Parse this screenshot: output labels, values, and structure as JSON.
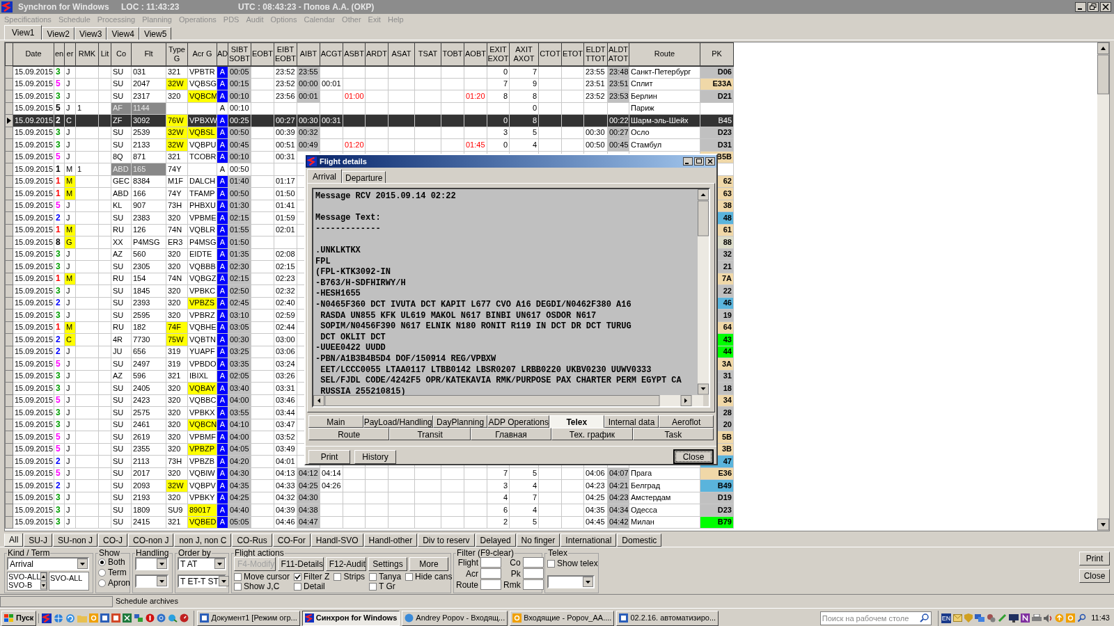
{
  "window": {
    "title": "Synchron for Windows",
    "loc": "LOC : 11:43:23",
    "utc": "UTC : 08:43:23 - Попов А.А. (ОКР)"
  },
  "menu": [
    "Specifications",
    "Schedule",
    "Processing",
    "Planning",
    "Operations",
    "PDS",
    "Audit",
    "Options",
    "Calendar",
    "Other",
    "Exit",
    "Help"
  ],
  "view_tabs": [
    {
      "label": "View1",
      "selected": true
    },
    {
      "label": "View2",
      "selected": false
    },
    {
      "label": "View3",
      "selected": false
    },
    {
      "label": "View4",
      "selected": false
    },
    {
      "label": "View5",
      "selected": false
    }
  ],
  "table": {
    "columns": [
      "Date",
      "en",
      "er",
      "RMK",
      "Lit",
      "Co",
      "Flt",
      "Type G",
      "Acr G",
      "AD",
      "SIBT SOBT",
      "EOBT",
      "EIBT EOBT",
      "AIBT",
      "ACGT",
      "ASBT",
      "ARDT",
      "ASAT",
      "TSAT",
      "TOBT",
      "AOBT",
      "EXIT EXOT",
      "AXIT AXOT",
      "CTOT",
      "ETOT",
      "ELDT TTOT",
      "ALDT ATOT",
      "Route",
      "PK"
    ],
    "rows": [
      {
        "date": "15.09.2015",
        "ter": {
          "text": "3",
          "color": "#00a000"
        },
        "cls": "J",
        "cls_marked": false,
        "co": "SU",
        "flt": "031",
        "type": "321",
        "type_marked": false,
        "acr": "VPBTR",
        "acr_marked": false,
        "ad": "A",
        "confirmed": true,
        "sibt": "00:05",
        "eibt": "23:52",
        "aibt": "23:55",
        "exit": "0",
        "axit": "7",
        "eldt": "23:55",
        "aldt": "23:48",
        "route": "Санкт-Петербург",
        "pk": {
          "text": "D06",
          "color": "#c0c0c0"
        },
        "selected": false
      },
      {
        "date": "15.09.2015",
        "ter": {
          "text": "5",
          "color": "#ff00ff"
        },
        "cls": "J",
        "cls_marked": false,
        "co": "SU",
        "flt": "2047",
        "type": "32W",
        "type_marked": true,
        "acr": "VQBSG",
        "acr_marked": false,
        "ad": "A",
        "confirmed": true,
        "sibt": "00:15",
        "eibt": "23:52",
        "aibt": "00:00",
        "acgt": "00:01",
        "exit": "7",
        "axit": "9",
        "eldt": "23:51",
        "aldt": "23:51",
        "route": "Сплит",
        "pk": {
          "text": "E33A",
          "color": "#f0d8a8"
        },
        "selected": false
      },
      {
        "date": "15.09.2015",
        "ter": {
          "text": "3",
          "color": "#00a000"
        },
        "cls": "J",
        "cls_marked": false,
        "co": "SU",
        "flt": "2317",
        "type": "320",
        "type_marked": false,
        "acr": "VQBCM",
        "acr_marked": true,
        "ad": "A",
        "confirmed": true,
        "sibt": "00:10",
        "eibt": "23:56",
        "aibt": "00:01",
        "asbt": "01:00",
        "aobt": "01:20",
        "exit": "8",
        "axit": "8",
        "eldt": "23:52",
        "aldt": "23:53",
        "route": "Берлин",
        "pk": {
          "text": "D21",
          "color": "#c0c0c0"
        },
        "selected": false
      },
      {
        "date": "15.09.2015",
        "ter": {
          "text": "5",
          "color": "#000000"
        },
        "cls": "J",
        "cls_marked": false,
        "rmk": "1",
        "co": "AF",
        "flt": "1144",
        "type_marked": false,
        "acr_marked": false,
        "ad": "A",
        "confirmed": false,
        "sibt": "00:10",
        "axit": "0",
        "route": "Париж",
        "selected": false
      },
      {
        "date": "15.09.2015",
        "ter": {
          "text": "2",
          "color": "#ffffff"
        },
        "cls": "C",
        "cls_marked": false,
        "co": "ZF",
        "flt": "3092",
        "type": "76W",
        "type_marked": true,
        "acr": "VPBXW",
        "acr_marked": false,
        "ad": "A",
        "confirmed": true,
        "sibt": "00:25",
        "eibt": "00:27",
        "aibt": "00:30",
        "acgt": "00:31",
        "exit": "0",
        "axit": "8",
        "aldt": "00:22",
        "route": "Шарм-эль-Шейх",
        "pk": {
          "text": "B45"
        },
        "selected": true
      },
      {
        "date": "15.09.2015",
        "ter": {
          "text": "3",
          "color": "#00a000"
        },
        "cls": "J",
        "cls_marked": false,
        "co": "SU",
        "flt": "2539",
        "type": "32W",
        "type_marked": true,
        "acr": "VQBSL",
        "acr_marked": true,
        "ad": "A",
        "confirmed": true,
        "sibt": "00:50",
        "eibt": "00:39",
        "aibt": "00:32",
        "exit": "3",
        "axit": "5",
        "eldt": "00:30",
        "aldt": "00:27",
        "route": "Осло",
        "pk": {
          "text": "D23",
          "color": "#c0c0c0"
        },
        "selected": false
      },
      {
        "date": "15.09.2015",
        "ter": {
          "text": "3",
          "color": "#00a000"
        },
        "cls": "J",
        "cls_marked": false,
        "co": "SU",
        "flt": "2133",
        "type": "32W",
        "type_marked": true,
        "acr": "VQBPU",
        "acr_marked": false,
        "ad": "A",
        "confirmed": true,
        "sibt": "00:45",
        "eibt": "00:51",
        "aibt": "00:49",
        "asbt": "01:20",
        "aobt": "01:45",
        "exit": "0",
        "axit": "4",
        "eldt": "00:50",
        "aldt": "00:45",
        "route": "Стамбул",
        "pk": {
          "text": "D31",
          "color": "#c0c0c0"
        },
        "selected": false
      },
      {
        "date": "15.09.2015",
        "ter": {
          "text": "5",
          "color": "#ff00ff"
        },
        "cls": "J",
        "cls_marked": false,
        "co": "8Q",
        "flt": "871",
        "type": "321",
        "type_marked": false,
        "acr": "TCOBR",
        "acr_marked": false,
        "ad": "A",
        "confirmed": true,
        "sibt": "00:10",
        "eibt": "00:31",
        "pk": {
          "text": "B5B",
          "color": "#f0d8a8"
        },
        "selected": false
      },
      {
        "date": "15.09.2015",
        "ter": {
          "text": "1",
          "color": "#000000"
        },
        "cls": "M",
        "cls_marked": false,
        "rmk": "1",
        "co": "ABD",
        "flt": "165",
        "type": "74Y",
        "type_marked": false,
        "acr_marked": false,
        "ad": "A",
        "confirmed": false,
        "sibt": "00:50",
        "selected": false
      },
      {
        "date": "15.09.2015",
        "ter": {
          "text": "1",
          "color": "#ff0000"
        },
        "cls": "M",
        "cls_marked": true,
        "co": "GEC",
        "flt": "8384",
        "type": "M1F",
        "type_marked": false,
        "acr": "DALCH",
        "acr_marked": false,
        "ad": "A",
        "confirmed": true,
        "sibt": "01:40",
        "eibt": "01:17",
        "pk": {
          "text": "62",
          "color": "#f0d8a8"
        },
        "selected": false
      },
      {
        "date": "15.09.2015",
        "ter": {
          "text": "1",
          "color": "#ff0000"
        },
        "cls": "M",
        "cls_marked": true,
        "co": "ABD",
        "flt": "166",
        "type": "74Y",
        "type_marked": false,
        "acr": "TFAMP",
        "acr_marked": false,
        "ad": "A",
        "confirmed": true,
        "sibt": "00:50",
        "eibt": "01:50",
        "pk": {
          "text": "63",
          "color": "#f0d8a8"
        },
        "selected": false
      },
      {
        "date": "15.09.2015",
        "ter": {
          "text": "5",
          "color": "#ff00ff"
        },
        "cls": "J",
        "cls_marked": false,
        "co": "KL",
        "flt": "907",
        "type": "73H",
        "type_marked": false,
        "acr": "PHBXU",
        "acr_marked": false,
        "ad": "A",
        "confirmed": true,
        "sibt": "01:30",
        "eibt": "01:41",
        "pk": {
          "text": "38",
          "color": "#f0d8a8"
        },
        "selected": false
      },
      {
        "date": "15.09.2015",
        "ter": {
          "text": "2",
          "color": "#0000ff"
        },
        "cls": "J",
        "cls_marked": false,
        "co": "SU",
        "flt": "2383",
        "type": "320",
        "type_marked": false,
        "acr": "VPBME",
        "acr_marked": false,
        "ad": "A",
        "confirmed": true,
        "sibt": "02:15",
        "eibt": "01:59",
        "pk": {
          "text": "48",
          "color": "#5ab4dc"
        },
        "selected": false
      },
      {
        "date": "15.09.2015",
        "ter": {
          "text": "1",
          "color": "#ff0000"
        },
        "cls": "M",
        "cls_marked": true,
        "co": "RU",
        "flt": "126",
        "type": "74N",
        "type_marked": false,
        "acr": "VQBLR",
        "acr_marked": false,
        "ad": "A",
        "confirmed": true,
        "sibt": "01:55",
        "eibt": "02:01",
        "pk": {
          "text": "61",
          "color": "#f0d8a8"
        },
        "selected": false
      },
      {
        "date": "15.09.2015",
        "ter": {
          "text": "8",
          "color": "#000000"
        },
        "cls": "G",
        "cls_marked": true,
        "co": "XX",
        "flt": "P4MSG",
        "type": "ER3",
        "type_marked": false,
        "acr": "P4MSG",
        "acr_marked": false,
        "ad": "A",
        "confirmed": true,
        "sibt": "01:50",
        "pk": {
          "text": "88",
          "color": "#dcdcc8"
        },
        "selected": false
      },
      {
        "date": "15.09.2015",
        "ter": {
          "text": "3",
          "color": "#00a000"
        },
        "cls": "J",
        "cls_marked": false,
        "co": "AZ",
        "flt": "560",
        "type": "320",
        "type_marked": false,
        "acr": "EIDTE",
        "acr_marked": false,
        "ad": "A",
        "confirmed": true,
        "sibt": "01:35",
        "eibt": "02:08",
        "pk": {
          "text": "32",
          "color": "#c0c0c0"
        },
        "selected": false
      },
      {
        "date": "15.09.2015",
        "ter": {
          "text": "3",
          "color": "#00a000"
        },
        "cls": "J",
        "cls_marked": false,
        "co": "SU",
        "flt": "2305",
        "type": "320",
        "type_marked": false,
        "acr": "VQBBB",
        "acr_marked": false,
        "ad": "A",
        "confirmed": true,
        "sibt": "02:30",
        "eibt": "02:15",
        "pk": {
          "text": "21",
          "color": "#c0c0c0"
        },
        "selected": false
      },
      {
        "date": "15.09.2015",
        "ter": {
          "text": "1",
          "color": "#ff0000"
        },
        "cls": "M",
        "cls_marked": true,
        "co": "RU",
        "flt": "154",
        "type": "74N",
        "type_marked": false,
        "acr": "VQBGZ",
        "acr_marked": false,
        "ad": "A",
        "confirmed": true,
        "sibt": "02:15",
        "eibt": "02:23",
        "pk": {
          "text": "7A",
          "color": "#f0d8a8"
        },
        "selected": false
      },
      {
        "date": "15.09.2015",
        "ter": {
          "text": "3",
          "color": "#00a000"
        },
        "cls": "J",
        "cls_marked": false,
        "co": "SU",
        "flt": "1845",
        "type": "320",
        "type_marked": false,
        "acr": "VPBKC",
        "acr_marked": false,
        "ad": "A",
        "confirmed": true,
        "sibt": "02:50",
        "eibt": "02:32",
        "pk": {
          "text": "22",
          "color": "#c0c0c0"
        },
        "selected": false
      },
      {
        "date": "15.09.2015",
        "ter": {
          "text": "2",
          "color": "#0000ff"
        },
        "cls": "J",
        "cls_marked": false,
        "co": "SU",
        "flt": "2393",
        "type": "320",
        "type_marked": false,
        "acr": "VPBZS",
        "acr_marked": true,
        "ad": "A",
        "confirmed": true,
        "sibt": "02:45",
        "eibt": "02:40",
        "pk": {
          "text": "46",
          "color": "#5ab4dc"
        },
        "selected": false
      },
      {
        "date": "15.09.2015",
        "ter": {
          "text": "3",
          "color": "#00a000"
        },
        "cls": "J",
        "cls_marked": false,
        "co": "SU",
        "flt": "2595",
        "type": "320",
        "type_marked": false,
        "acr": "VPBRZ",
        "acr_marked": false,
        "ad": "A",
        "confirmed": true,
        "sibt": "03:10",
        "eibt": "02:59",
        "pk": {
          "text": "19",
          "color": "#c0c0c0"
        },
        "selected": false
      },
      {
        "date": "15.09.2015",
        "ter": {
          "text": "1",
          "color": "#ff0000"
        },
        "cls": "M",
        "cls_marked": true,
        "co": "RU",
        "flt": "182",
        "type": "74F",
        "type_marked": true,
        "acr": "VQBHE",
        "acr_marked": false,
        "ad": "A",
        "confirmed": true,
        "sibt": "03:05",
        "eibt": "02:44",
        "pk": {
          "text": "64",
          "color": "#f0d8a8"
        },
        "selected": false
      },
      {
        "date": "15.09.2015",
        "ter": {
          "text": "2",
          "color": "#0000ff"
        },
        "cls": "C",
        "cls_marked": true,
        "co": "4R",
        "flt": "7730",
        "type": "75W",
        "type_marked": true,
        "acr": "VQBTN",
        "acr_marked": false,
        "ad": "A",
        "confirmed": true,
        "sibt": "00:30",
        "eibt": "03:00",
        "pk": {
          "text": "43",
          "color": "#00ff00"
        },
        "selected": false
      },
      {
        "date": "15.09.2015",
        "ter": {
          "text": "2",
          "color": "#0000ff"
        },
        "cls": "J",
        "cls_marked": false,
        "co": "JU",
        "flt": "656",
        "type": "319",
        "type_marked": false,
        "acr": "YUAPF",
        "acr_marked": false,
        "ad": "A",
        "confirmed": true,
        "sibt": "03:25",
        "eibt": "03:06",
        "pk": {
          "text": "44",
          "color": "#00ff00"
        },
        "selected": false
      },
      {
        "date": "15.09.2015",
        "ter": {
          "text": "5",
          "color": "#ff00ff"
        },
        "cls": "J",
        "cls_marked": false,
        "co": "SU",
        "flt": "2497",
        "type": "319",
        "type_marked": false,
        "acr": "VPBDO",
        "acr_marked": false,
        "ad": "A",
        "confirmed": true,
        "sibt": "03:35",
        "eibt": "03:24",
        "pk": {
          "text": "3A",
          "color": "#f0d8a8"
        },
        "selected": false
      },
      {
        "date": "15.09.2015",
        "ter": {
          "text": "3",
          "color": "#00a000"
        },
        "cls": "J",
        "cls_marked": false,
        "co": "AZ",
        "flt": "596",
        "type": "321",
        "type_marked": false,
        "acr": "IBIXL",
        "acr_marked": false,
        "ad": "A",
        "confirmed": true,
        "sibt": "02:05",
        "eibt": "03:26",
        "pk": {
          "text": "31",
          "color": "#c0c0c0"
        },
        "selected": false
      },
      {
        "date": "15.09.2015",
        "ter": {
          "text": "3",
          "color": "#00a000"
        },
        "cls": "J",
        "cls_marked": false,
        "co": "SU",
        "flt": "2405",
        "type": "320",
        "type_marked": false,
        "acr": "VQBAY",
        "acr_marked": true,
        "ad": "A",
        "confirmed": true,
        "sibt": "03:40",
        "eibt": "03:31",
        "pk": {
          "text": "18",
          "color": "#c0c0c0"
        },
        "selected": false
      },
      {
        "date": "15.09.2015",
        "ter": {
          "text": "5",
          "color": "#ff00ff"
        },
        "cls": "J",
        "cls_marked": false,
        "co": "SU",
        "flt": "2423",
        "type": "320",
        "type_marked": false,
        "acr": "VQBBC",
        "acr_marked": false,
        "ad": "A",
        "confirmed": true,
        "sibt": "04:00",
        "eibt": "03:46",
        "pk": {
          "text": "34",
          "color": "#f0d8a8"
        },
        "selected": false
      },
      {
        "date": "15.09.2015",
        "ter": {
          "text": "3",
          "color": "#00a000"
        },
        "cls": "J",
        "cls_marked": false,
        "co": "SU",
        "flt": "2575",
        "type": "320",
        "type_marked": false,
        "acr": "VPBKX",
        "acr_marked": false,
        "ad": "A",
        "confirmed": true,
        "sibt": "03:55",
        "eibt": "03:44",
        "pk": {
          "text": "28",
          "color": "#c0c0c0"
        },
        "selected": false
      },
      {
        "date": "15.09.2015",
        "ter": {
          "text": "3",
          "color": "#00a000"
        },
        "cls": "J",
        "cls_marked": false,
        "co": "SU",
        "flt": "2461",
        "type": "320",
        "type_marked": false,
        "acr": "VQBCN",
        "acr_marked": true,
        "ad": "A",
        "confirmed": true,
        "sibt": "04:10",
        "eibt": "03:47",
        "pk": {
          "text": "20",
          "color": "#c0c0c0"
        },
        "selected": false
      },
      {
        "date": "15.09.2015",
        "ter": {
          "text": "5",
          "color": "#ff00ff"
        },
        "cls": "J",
        "cls_marked": false,
        "co": "SU",
        "flt": "2619",
        "type": "320",
        "type_marked": false,
        "acr": "VPBMF",
        "acr_marked": false,
        "ad": "A",
        "confirmed": true,
        "sibt": "04:00",
        "eibt": "03:52",
        "pk": {
          "text": "5B",
          "color": "#f0d8a8"
        },
        "selected": false
      },
      {
        "date": "15.09.2015",
        "ter": {
          "text": "5",
          "color": "#ff00ff"
        },
        "cls": "J",
        "cls_marked": false,
        "co": "SU",
        "flt": "2355",
        "type": "320",
        "type_marked": false,
        "acr": "VPBZP",
        "acr_marked": true,
        "ad": "A",
        "confirmed": true,
        "sibt": "04:05",
        "eibt": "03:49",
        "pk": {
          "text": "3B",
          "color": "#f0d8a8"
        },
        "selected": false
      },
      {
        "date": "15.09.2015",
        "ter": {
          "text": "2",
          "color": "#0000ff"
        },
        "cls": "J",
        "cls_marked": false,
        "co": "SU",
        "flt": "2113",
        "type": "73H",
        "type_marked": false,
        "acr": "VPBZB",
        "acr_marked": false,
        "ad": "A",
        "confirmed": true,
        "sibt": "04:20",
        "eibt": "04:01",
        "pk": {
          "text": "47",
          "color": "#5ab4dc"
        },
        "selected": false
      },
      {
        "date": "15.09.2015",
        "ter": {
          "text": "5",
          "color": "#ff00ff"
        },
        "cls": "J",
        "cls_marked": false,
        "co": "SU",
        "flt": "2017",
        "type": "320",
        "type_marked": false,
        "acr": "VQBIW",
        "acr_marked": false,
        "ad": "A",
        "confirmed": true,
        "sibt": "04:30",
        "eibt": "04:13",
        "aibt": "04:12",
        "acgt": "04:14",
        "exit": "7",
        "axit": "5",
        "eldt": "04:06",
        "aldt": "04:07",
        "route": "Прага",
        "pk": {
          "text": "E36",
          "color": "#f0d8a8"
        },
        "selected": false
      },
      {
        "date": "15.09.2015",
        "ter": {
          "text": "2",
          "color": "#0000ff"
        },
        "cls": "J",
        "cls_marked": false,
        "co": "SU",
        "flt": "2093",
        "type": "32W",
        "type_marked": true,
        "acr": "VQBPV",
        "acr_marked": false,
        "ad": "A",
        "confirmed": true,
        "sibt": "04:35",
        "eibt": "04:33",
        "aibt": "04:25",
        "acgt": "04:26",
        "exit": "3",
        "axit": "4",
        "eldt": "04:23",
        "aldt": "04:21",
        "route": "Белград",
        "pk": {
          "text": "B49",
          "color": "#5ab4dc"
        },
        "selected": false
      },
      {
        "date": "15.09.2015",
        "ter": {
          "text": "3",
          "color": "#00a000"
        },
        "cls": "J",
        "cls_marked": false,
        "co": "SU",
        "flt": "2193",
        "type": "320",
        "type_marked": false,
        "acr": "VPBKY",
        "acr_marked": false,
        "ad": "A",
        "confirmed": true,
        "sibt": "04:25",
        "eibt": "04:32",
        "aibt": "04:30",
        "exit": "4",
        "axit": "7",
        "eldt": "04:25",
        "aldt": "04:23",
        "route": "Амстердам",
        "pk": {
          "text": "D19",
          "color": "#c0c0c0"
        },
        "selected": false
      },
      {
        "date": "15.09.2015",
        "ter": {
          "text": "3",
          "color": "#00a000"
        },
        "cls": "J",
        "cls_marked": false,
        "co": "SU",
        "flt": "1809",
        "type": "SU9",
        "type_marked": false,
        "acr": "89017",
        "acr_marked": true,
        "ad": "A",
        "confirmed": true,
        "sibt": "04:40",
        "eibt": "04:39",
        "aibt": "04:38",
        "exit": "6",
        "axit": "4",
        "eldt": "04:35",
        "aldt": "04:34",
        "route": "Одесса",
        "pk": {
          "text": "D23",
          "color": "#c0c0c0"
        },
        "selected": false
      },
      {
        "date": "15.09.2015",
        "ter": {
          "text": "3",
          "color": "#00a000"
        },
        "cls": "J",
        "cls_marked": false,
        "co": "SU",
        "flt": "2415",
        "type": "321",
        "type_marked": false,
        "acr": "VQBED",
        "acr_marked": true,
        "ad": "A",
        "confirmed": true,
        "sibt": "05:05",
        "eibt": "04:46",
        "aibt": "04:47",
        "exit": "2",
        "axit": "5",
        "eldt": "04:45",
        "aldt": "04:42",
        "route": "Милан",
        "pk": {
          "text": "B79",
          "color": "#00ff00"
        },
        "selected": false
      }
    ]
  },
  "dialog": {
    "title": "Flight details",
    "tabs": [
      {
        "label": "Arrival",
        "selected": true
      },
      {
        "label": "Departure",
        "selected": false
      }
    ],
    "telex": "Message RCV 2015.09.14 02:22\n\nMessage Text:\n-------------\n\n.UNKLKTKX\nFPL\n(FPL-KTK3092-IN\n-B763/H-SDFHIRWY/H\n-HESH1655\n-N0465F360 DCT IVUTA DCT KAPIT L677 CVO A16 DEGDI/N0462F380 A16\n RASDA UN855 KFK UL619 MAKOL N617 BINBI UN617 OSDOR N617\n SOPIM/N0456F390 N617 ELNIK N180 RONIT R119 IN DCT DR DCT TURUG\n DCT OKLIT DCT\n-UUEE0422 UUDD\n-PBN/A1B3B4B5D4 DOF/150914 REG/VPBXW\n EET/LCCC0055 LTAA0117 LTBB0142 LBSR0207 LRBB0220 UKBV0230 UUWV0333\n SEL/FJDL CODE/4242F5 OPR/KATEKAVIA RMK/PURPOSE PAX CHARTER PERM EGYPT CA\n RUSSIA 255210815)",
    "page_tabs": [
      [
        {
          "label": "Main",
          "selected": false
        },
        {
          "label": "PayLoad/Handling",
          "selected": false
        },
        {
          "label": "DayPlanning",
          "selected": false
        },
        {
          "label": "ADP Operations",
          "selected": false
        },
        {
          "label": "Telex",
          "selected": true
        },
        {
          "label": "Internal data",
          "selected": false
        },
        {
          "label": "Aeroflot",
          "selected": false
        }
      ],
      [
        {
          "label": "Route",
          "selected": false
        },
        {
          "label": "Transit",
          "selected": false
        },
        {
          "label": "Главная",
          "selected": false
        },
        {
          "label": "Тех. график",
          "selected": false
        },
        {
          "label": "Task",
          "selected": false
        }
      ]
    ],
    "buttons": [
      "Print",
      "History"
    ],
    "close": "Close"
  },
  "filter_tabs": [
    {
      "label": "All",
      "selected": true
    },
    {
      "label": "SU-J",
      "selected": false
    },
    {
      "label": "SU-non J",
      "selected": false
    },
    {
      "label": "CO-J",
      "selected": false
    },
    {
      "label": "CO-non J",
      "selected": false
    },
    {
      "label": "non J, non C",
      "selected": false
    },
    {
      "label": "CO-Rus",
      "selected": false
    },
    {
      "label": "CO-For",
      "selected": false
    },
    {
      "label": "Handl-SVO",
      "selected": false
    },
    {
      "label": "Handl-other",
      "selected": false
    },
    {
      "label": "Div to reserv",
      "selected": false
    },
    {
      "label": "Delayed",
      "selected": false
    },
    {
      "label": "No finger",
      "selected": false
    },
    {
      "label": "International",
      "selected": false
    },
    {
      "label": "Domestic",
      "selected": false
    }
  ],
  "controls": {
    "kind_term": {
      "label": "Kind / Term",
      "select": "Arrival",
      "list": [
        "SVO-ALL",
        "SVO-B"
      ],
      "field": "SVO-ALL"
    },
    "show": {
      "label": "Show",
      "options": [
        {
          "label": "Both",
          "selected": true
        },
        {
          "label": "Term",
          "selected": false
        },
        {
          "label": "Apron",
          "selected": false
        }
      ]
    },
    "handling": {
      "label": "Handling"
    },
    "order_by": {
      "label": "Order by",
      "selects": [
        "T AT",
        "T ET-T ST"
      ]
    },
    "flight_actions": {
      "label": "Flight actions",
      "buttons": [
        {
          "label": "F4-Modify",
          "disabled": true
        },
        {
          "label": "F11-Details",
          "disabled": false
        },
        {
          "label": "F12-Audit",
          "disabled": false
        },
        {
          "label": "Settings",
          "disabled": false
        },
        {
          "label": "More",
          "disabled": false
        }
      ],
      "checkboxes": [
        [
          {
            "label": "Move cursor",
            "checked": false
          },
          {
            "label": "Filter Z",
            "checked": true
          },
          {
            "label": "Strips",
            "checked": false
          },
          {
            "label": "Tanya",
            "checked": false
          },
          {
            "label": "Hide cans",
            "checked": false
          }
        ],
        [
          {
            "label": "Show J,C",
            "checked": false
          },
          {
            "label": "Detail",
            "checked": false
          },
          {
            "label": "T Gr",
            "checked": false
          }
        ]
      ]
    },
    "filter": {
      "label": "Filter (F9-clear)",
      "fields": [
        "Flight",
        "Co",
        "Acr",
        "Pk",
        "Route",
        "Rmk"
      ]
    },
    "telex": {
      "label": "Telex",
      "checkbox": {
        "label": "Show telex",
        "checked": false
      }
    },
    "side_buttons": [
      "Print",
      "Close"
    ]
  },
  "status_bar": [
    "Schedule archives"
  ],
  "taskbar": {
    "start": "Пуск",
    "tasks": [
      {
        "label": "Документ1 [Режим огр...",
        "selected": false
      },
      {
        "label": "Синхрон for Windows",
        "selected": true
      },
      {
        "label": "Andrey Popov - Входящ...",
        "selected": false
      },
      {
        "label": "Входящие - Popov_AA....",
        "selected": false
      },
      {
        "label": "02.2.16. автоматизиро...",
        "selected": false
      }
    ],
    "search": {
      "placeholder": "Поиск на рабочем столе"
    },
    "language": "EN",
    "time": "11:43"
  }
}
